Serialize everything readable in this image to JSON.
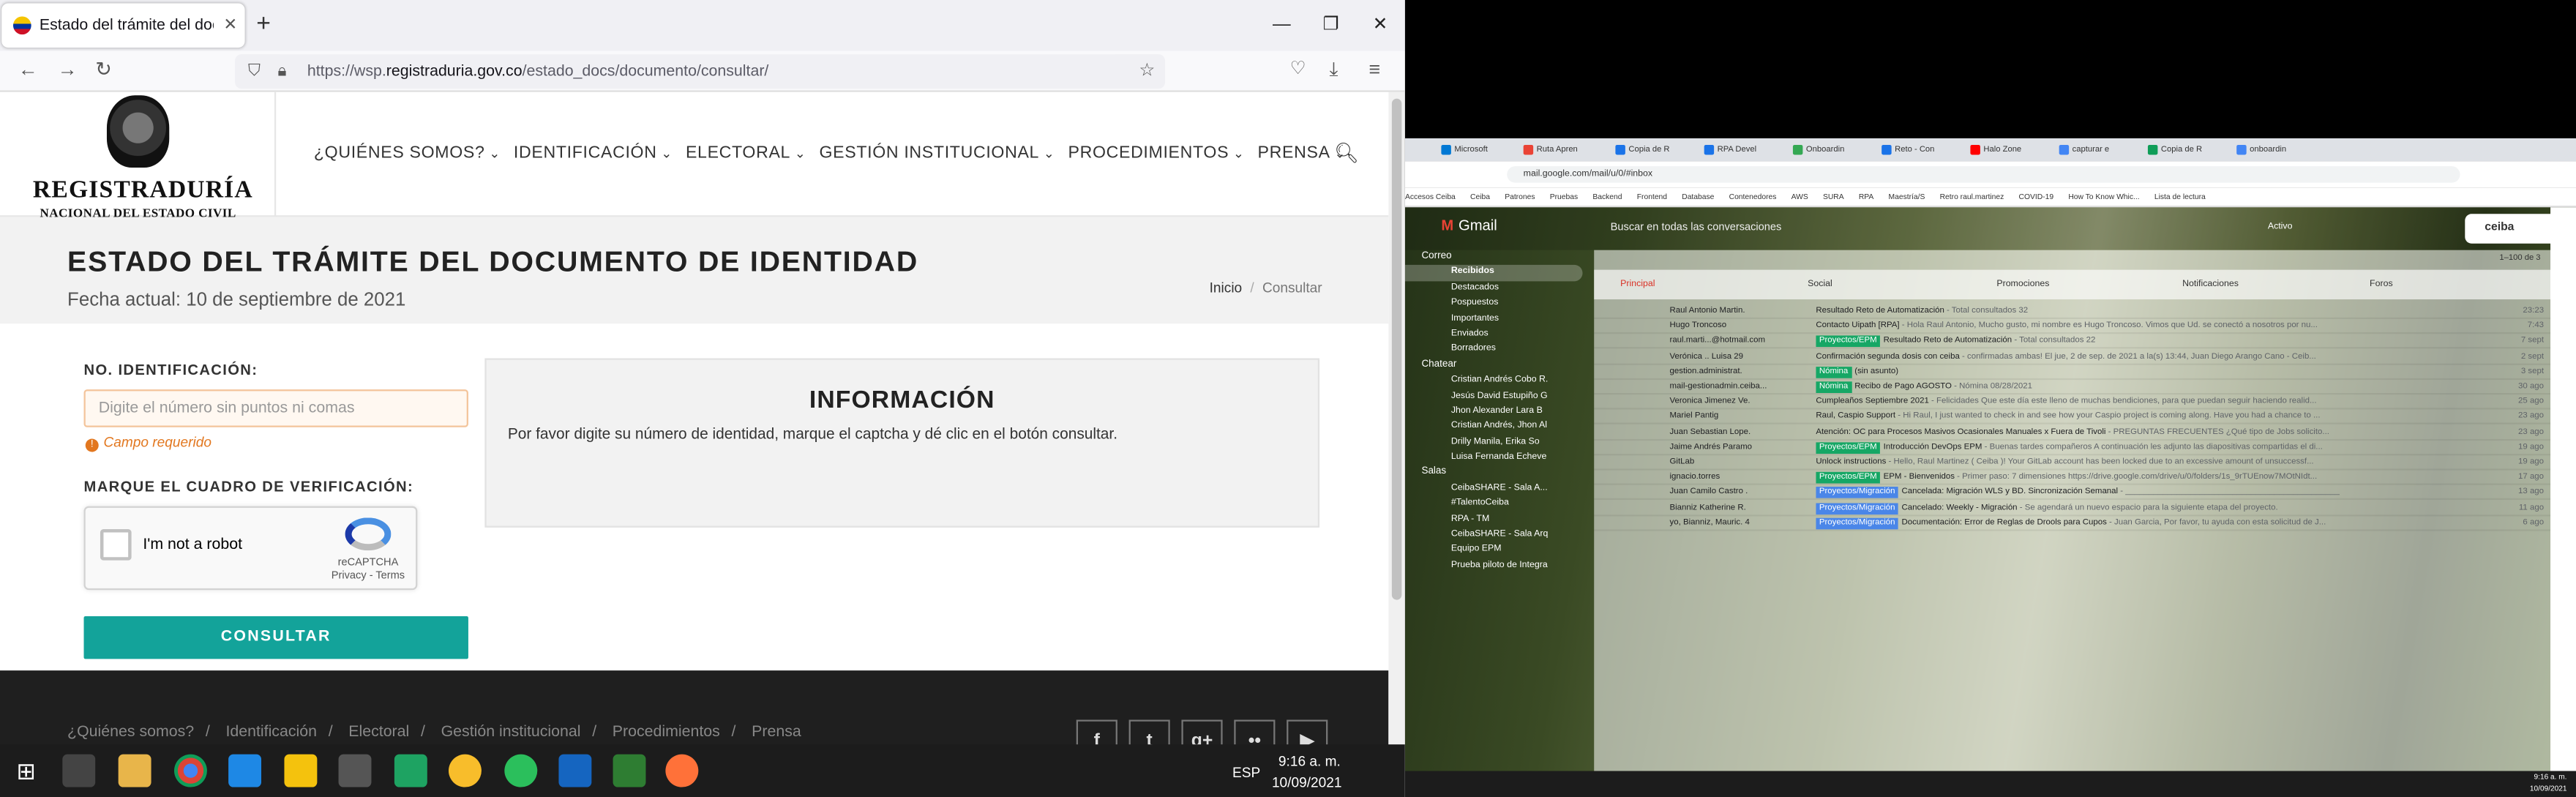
{
  "firefox": {
    "tab_title": "Estado del trámite del documento",
    "url_prefix": "https://wsp.",
    "url_domain": "registraduria.gov.co",
    "url_path": "/estado_docs/documento/consultar/"
  },
  "site": {
    "logo_line1": "REGISTRADURÍA",
    "logo_line2": "NACIONAL DEL ESTADO CIVIL",
    "menu": [
      "¿QUIÉNES SOMOS?",
      "IDENTIFICACIÓN",
      "ELECTORAL",
      "GESTIÓN INSTITUCIONAL",
      "PROCEDIMIENTOS",
      "PRENSA"
    ],
    "page_title": "ESTADO DEL TRÁMITE DEL DOCUMENTO DE IDENTIDAD",
    "fecha": "Fecha actual: 10 de septiembre de 2021",
    "crumb_home": "Inicio",
    "crumb_current": "Consultar",
    "id_label": "NO. IDENTIFICACIÓN:",
    "id_placeholder": "Digite el número sin puntos ni comas",
    "required_msg": "Campo requerido",
    "captcha_label": "MARQUE EL CUADRO DE VERIFICACIÓN:",
    "captcha_text": "I'm not a robot",
    "captcha_brand": "reCAPTCHA",
    "captcha_links": "Privacy - Terms",
    "submit": "CONSULTAR",
    "info_title": "INFORMACIÓN",
    "info_text": "Por favor digite su número de identidad, marque el captcha y dé clic en el botón consultar.",
    "footer_links": [
      "¿Quiénes somos?",
      "Identificación",
      "Electoral",
      "Gestión institucional",
      "Procedimientos",
      "Prensa"
    ],
    "social": [
      "f",
      "t",
      "g+",
      "••",
      "▶"
    ]
  },
  "taskbar_left": {
    "time": "9:16 a. m.",
    "date": "10/09/2021",
    "lang": "ESP"
  },
  "chrome": {
    "tabs": [
      "Microsoft",
      "Ruta Apren",
      "Copia de R",
      "RPA Devel",
      "Onboardin",
      "Reto - Con",
      "Halo Zone",
      "capturar e",
      "Copia de R",
      "onboardin"
    ],
    "url": "mail.google.com/mail/u/0/#inbox",
    "bookmarks": [
      "Accesos Ceiba",
      "Ceiba",
      "Patrones",
      "Pruebas",
      "Backend",
      "Frontend",
      "Database",
      "Contenedores",
      "AWS",
      "SURA",
      "RPA",
      "Maestría/S",
      "Retro raul.martinez",
      "COVID-19",
      "How To Know Whic...",
      "Lista de lectura"
    ]
  },
  "gmail": {
    "brand": "Gmail",
    "search_placeholder": "Buscar en todas las conversaciones",
    "status": "Activo",
    "org": "ceiba",
    "range": "1–100 de 3",
    "nav": [
      {
        "label": "Recibidos",
        "sel": true
      },
      {
        "label": "Destacados"
      },
      {
        "label": "Pospuestos"
      },
      {
        "label": "Importantes"
      },
      {
        "label": "Enviados"
      },
      {
        "label": "Borradores"
      }
    ],
    "chat_header": "Chatear",
    "mail_header": "Correo",
    "chats": [
      "Cristian Andrés Cobo R.",
      "Jesús David Estupiño G",
      "Jhon Alexander Lara B",
      "Cristian Andrés, Jhon Al",
      "Drilly Manila, Erika So",
      "Luisa Fernanda Echeve"
    ],
    "rooms_header": "Salas",
    "rooms": [
      "CeibaSHARE - Sala A...",
      "#TalentoCeiba",
      "RPA - TM",
      "CeibaSHARE - Sala Arq",
      "Equipo EPM",
      "Prueba piloto de Integra"
    ],
    "tabs": [
      "Principal",
      "Social",
      "Promociones",
      "Notificaciones",
      "Foros"
    ],
    "rows": [
      {
        "from": "Raul Antonio Martin.",
        "tag": "",
        "subject": "Resultado Reto de Automatización",
        "snippet": " - Total consultados 32",
        "date": "23:23"
      },
      {
        "from": "Hugo Troncoso",
        "tag": "",
        "subject": "Contacto Uipath [RPA]",
        "snippet": " - Hola Raul Antonio, Mucho gusto, mi nombre es Hugo Troncoso. Vimos que Ud. se conectó a nosotros por nu...",
        "date": "7:43"
      },
      {
        "from": "raul.marti...@hotmail.com",
        "tag": "Proyectos/EPM",
        "subject": "Resultado Reto de Automatización",
        "snippet": " - Total consultados 22",
        "date": "7 sept"
      },
      {
        "from": "Verónica .. Luisa 29",
        "tag": "",
        "subject": "Confirmación segunda dosis con ceiba",
        "snippet": " - confirmadas ambas! El jue, 2 de sep. de 2021 a la(s) 13:44, Juan Diego Arango Cano - Ceib...",
        "date": "2 sept"
      },
      {
        "from": "gestion.administrat.",
        "tag": "Nómina",
        "subject": "(sin asunto)",
        "snippet": "",
        "date": "3 sept"
      },
      {
        "from": "mail-gestionadmin.ceiba...",
        "tag": "Nómina",
        "subject": "Recibo de Pago AGOSTO",
        "snippet": " - Nómina 08/28/2021",
        "date": "30 ago"
      },
      {
        "from": "Veronica Jimenez Ve.",
        "tag": "",
        "subject": "Cumpleaños Septiembre 2021",
        "snippet": " - Felicidades Que este día este lleno de muchas bendiciones, para que puedan seguir haciendo realid...",
        "date": "25 ago"
      },
      {
        "from": "Mariel Pantig",
        "tag": "",
        "subject": "Raul, Caspio Support",
        "snippet": " - Hi Raul, I just wanted to check in and see how your Caspio project is coming along. Have you had a chance to ...",
        "date": "23 ago"
      },
      {
        "from": "Juan Sebastian Lope.",
        "tag": "",
        "subject": "Atención: OC para Procesos Masivos Ocasionales Manuales x Fuera de Tivoli",
        "snippet": " - PREGUNTAS FRECUENTES ¿Qué tipo de Jobs solicito...",
        "date": "23 ago"
      },
      {
        "from": "Jaime Andrés Paramo",
        "tag": "Proyectos/EPM",
        "subject": "Introducción DevOps EPM",
        "snippet": " - Buenas tardes compañeros A continuación les adjunto las diapositivas compartidas el di...",
        "date": "19 ago"
      },
      {
        "from": "GitLab",
        "tag": "",
        "subject": "Unlock instructions",
        "snippet": " - Hello, Raul Martinez ( Ceiba )! Your GitLab account has been locked due to an excessive amount of unsuccessf...",
        "date": "19 ago"
      },
      {
        "from": "ignacio.torres",
        "tag": "Proyectos/EPM",
        "subject": "EPM - Bienvenidos",
        "snippet": " - Primer paso: 7 dimensiones https://drive.google.com/drive/u/0/folders/1s_9rTUEnow7MOtNIdt...",
        "date": "17 ago"
      },
      {
        "from": "Juan Camilo Castro .",
        "tag": "Proyectos/Migración",
        "subject": "Cancelada: Migración WLS y BD. Sincronización Semanal",
        "snippet": " - ______________________________________________",
        "date": "13 ago"
      },
      {
        "from": "Bianniz Katherine R.",
        "tag": "Proyectos/Migración",
        "subject": "Cancelado: Weekly - Migración",
        "snippet": " - Se agendará un nuevo espacio para la siguiente etapa del proyecto.",
        "date": "11 ago"
      },
      {
        "from": "yo, Bianniz, Mauric. 4",
        "tag": "Proyectos/Migración",
        "subject": "Documentación: Error de Reglas de Drools para Cupos",
        "snippet": " - Juan Garcia, Por favor, tu ayuda con esta solicitud de J...",
        "date": "6 ago"
      }
    ]
  },
  "taskbar_right": {
    "time": "9:16 a. m.",
    "date": "10/09/2021"
  }
}
